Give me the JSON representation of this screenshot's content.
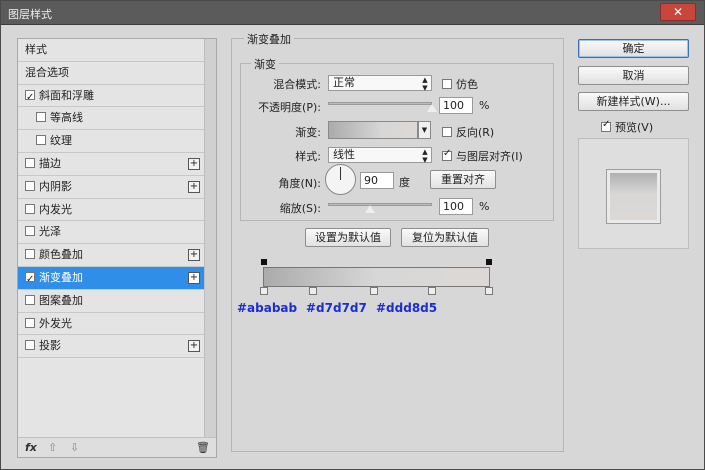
{
  "window": {
    "title": "图层样式",
    "close_glyph": "✕"
  },
  "style_list": {
    "items": [
      {
        "label": "样式",
        "checkbox": false,
        "checked": false,
        "plus": false,
        "selected": false,
        "sub": false
      },
      {
        "label": "混合选项",
        "checkbox": false,
        "checked": false,
        "plus": false,
        "selected": false,
        "sub": false
      },
      {
        "label": "斜面和浮雕",
        "checkbox": true,
        "checked": true,
        "plus": false,
        "selected": false,
        "sub": false
      },
      {
        "label": "等高线",
        "checkbox": true,
        "checked": false,
        "plus": false,
        "selected": false,
        "sub": true
      },
      {
        "label": "纹理",
        "checkbox": true,
        "checked": false,
        "plus": false,
        "selected": false,
        "sub": true
      },
      {
        "label": "描边",
        "checkbox": true,
        "checked": false,
        "plus": true,
        "selected": false,
        "sub": false
      },
      {
        "label": "内阴影",
        "checkbox": true,
        "checked": false,
        "plus": true,
        "selected": false,
        "sub": false
      },
      {
        "label": "内发光",
        "checkbox": true,
        "checked": false,
        "plus": false,
        "selected": false,
        "sub": false
      },
      {
        "label": "光泽",
        "checkbox": true,
        "checked": false,
        "plus": false,
        "selected": false,
        "sub": false
      },
      {
        "label": "颜色叠加",
        "checkbox": true,
        "checked": false,
        "plus": true,
        "selected": false,
        "sub": false
      },
      {
        "label": "渐变叠加",
        "checkbox": true,
        "checked": true,
        "plus": true,
        "selected": true,
        "sub": false
      },
      {
        "label": "图案叠加",
        "checkbox": true,
        "checked": false,
        "plus": false,
        "selected": false,
        "sub": false
      },
      {
        "label": "外发光",
        "checkbox": true,
        "checked": false,
        "plus": false,
        "selected": false,
        "sub": false
      },
      {
        "label": "投影",
        "checkbox": true,
        "checked": false,
        "plus": true,
        "selected": false,
        "sub": false
      }
    ],
    "plus_glyph": "+",
    "footer": {
      "fx": "fx",
      "up": "⇧",
      "down": "⇩",
      "trash": "🗑"
    }
  },
  "panel": {
    "section_title": "渐变叠加",
    "group_title": "渐变",
    "blend_mode_label": "混合模式:",
    "blend_mode_value": "正常",
    "dither_label": "仿色",
    "opacity_label": "不透明度(P):",
    "opacity_value": "100",
    "opacity_unit": "%",
    "opacity_level": 1.0,
    "gradient_label": "渐变:",
    "reverse_label": "反向(R)",
    "style_label": "样式:",
    "style_value": "线性",
    "align_label": "与图层对齐(I)",
    "angle_label": "角度(N):",
    "angle_value": "90",
    "angle_unit": "度",
    "reset_align_button": "重置对齐",
    "scale_label": "缩放(S):",
    "scale_value": "100",
    "scale_unit": "%",
    "scale_level": 0.4,
    "make_default_button": "设置为默认值",
    "reset_default_button": "复位为默认值",
    "arrows_glyph": "▲▼",
    "dropdown_glyph": "▼"
  },
  "gradient_editor": {
    "colors": [
      "#ababab",
      "#d7d7d7",
      "#ddd8d5"
    ],
    "hex_labels": [
      "#ababab",
      "#d7d7d7",
      "#ddd8d5"
    ],
    "hex_color": "#1a2ed6"
  },
  "right": {
    "ok_button": "确定",
    "cancel_button": "取消",
    "new_style_button": "新建样式(W)...",
    "preview_label": "预览(V)",
    "preview_checked": true
  },
  "colors": {
    "selection": "#2f8ee8",
    "dialog_bg": "#d7d7d7",
    "titlebar": "#5b5b5b",
    "close": "#c9463d"
  }
}
